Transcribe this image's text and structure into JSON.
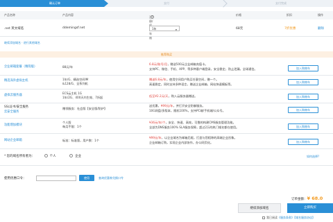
{
  "steps": [
    "确认订单",
    "支付",
    "支付完成"
  ],
  "columns": {
    "product_name": "产品名称",
    "product_content": "产品内容",
    "term": "注册/续费年限",
    "term_hint": "?",
    "price": "价格",
    "discount": "折扣",
    "action": "操作"
  },
  "product": {
    "name": ".net 英文域名",
    "content": "ddemingsf.net",
    "term_value": "1年",
    "price": "68元",
    "discount": "7折优惠",
    "delete": "删除"
  },
  "bulk_link": "继续添加域名 · 进行其他域名",
  "banner": "推荐购买",
  "services": [
    {
      "name": "企业邮箱套餐（精简版）",
      "name_dark": false,
      "price": "88元/年",
      "desc_red": "6.8元/账号/月",
      "desc": "，赠送500元企业邮箱充值卡。",
      "desc2": "支持PC、微信、手机、APP、等多种客户端登录，安全稳定，防止泄漏，全球通信。",
      "add": "加入购物车"
    },
    {
      "name": "精选海外虚拟主机",
      "name_dark": false,
      "price": "1年/G、精选空间IM",
      "price2": "&128/G、全系列机",
      "desc_red": "赠送6.8元/年",
      "desc": "，使用空间用户购买任意空间，赠一个。",
      "desc2": "高速稳定，同时支持多种语言，赠送企业邮箱、网站快速模板等。",
      "add": "加入购物车"
    },
    {
      "name": "虚拟云服务器",
      "name_dark": false,
      "price": "ECS云主机 1G",
      "price2": "1年/2G、400天内生效、7折起",
      "desc_red": "低至¥2.2元/天",
      "desc": "，购入云服务器赠送。",
      "add": "加入购物车"
    },
    {
      "name": "SSL证书/安全服务",
      "name_dark": true,
      "name2": "云安全服务",
      "price": "赠领服务：社会版【安全版/防护】",
      "desc": "10G网盘/多版本，随机100%，支持PC端/手机端/公众号。",
      "desc_pre": "送优惠，",
      "desc_red": "¥99元/年",
      "desc_post": "，并打开安全防御服务。",
      "add": "加入购物车"
    },
    {
      "name": "功能增加模块",
      "name_dark": false,
      "price": "个人版",
      "price2": "每月不限：1个",
      "desc_red": "¥36元/年/个",
      "desc": "，安全、快速、高效，可靠的构建CMS服务管理功能。",
      "desc2": "全部为DNS服务100% SLA服务保障，超过2万的热门域名都在使用。",
      "add": "加入购物车"
    },
    {
      "name": "网站企业邮箱",
      "name_dark": false,
      "price": "标准：标准版，用户数：1个",
      "desc_red": "¥99元/年",
      "desc": "，以企业域名为邮箱后缀，打造与您相称的高端企业形象。",
      "desc2": "企业邮箱订购，实现企业内部协作，办公网页化。",
      "add": "加入购物车"
    }
  ],
  "holder": {
    "label": "* 您的域名所有者为：",
    "personal": "个人",
    "enterprise": "企业",
    "help": "如何选择?"
  },
  "coupon": {
    "label": "使用优惠口令：",
    "placeholder": "",
    "use_button": "使用",
    "view_link": "查询优惠券兑换口令"
  },
  "summary": {
    "total_label": "订单金额：",
    "total_value": "¥ 68.0",
    "continue_button": "继续添加域名",
    "submit_button": "立即购买",
    "agree_prefix": "我已阅读",
    "agreement": "《服务条款》",
    "agreement2": "【域名服务协议】"
  }
}
